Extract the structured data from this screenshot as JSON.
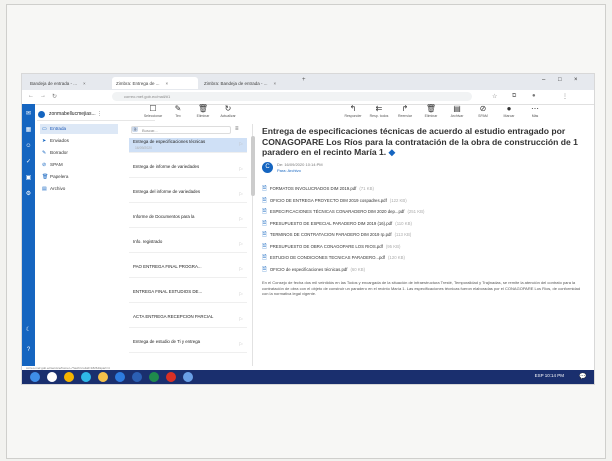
{
  "browser": {
    "tabs": [
      {
        "label": "Bandeja de entrada - ...",
        "active": false
      },
      {
        "label": "Zimbra: Entrega de ...",
        "active": true
      },
      {
        "label": "Zimbra: Bandeja de entrada - ...",
        "active": false
      }
    ],
    "new_tab": "+",
    "window_controls": [
      "–",
      "□",
      "×"
    ],
    "url": "correo.mef.gob.ec/mail/#1"
  },
  "rail_icons": [
    "mail-icon",
    "calendar-icon",
    "contacts-icon",
    "tasks-icon",
    "briefcase-icon",
    "settings-icon"
  ],
  "bottom_rail_icons": [
    "moon-icon",
    "help-icon"
  ],
  "account": {
    "label": "zonmabellucmejias..."
  },
  "folders": [
    {
      "label": "Entrada",
      "icon": "inbox-icon",
      "selected": true,
      "badge": "1"
    },
    {
      "label": "Enviados",
      "icon": "send-icon",
      "selected": false,
      "badge": ""
    },
    {
      "label": "Borrador",
      "icon": "draft-icon",
      "selected": false,
      "badge": ""
    },
    {
      "label": "SPAM",
      "icon": "spam-icon",
      "selected": false,
      "badge": ""
    },
    {
      "label": "Papelera",
      "icon": "trash-icon",
      "selected": false,
      "badge": ""
    },
    {
      "label": "Archivo",
      "icon": "archive-icon",
      "selected": false,
      "badge": ""
    }
  ],
  "toolbar_left": [
    {
      "label": "Seleccionar",
      "glyph": "☐"
    },
    {
      "label": "Tex",
      "glyph": "✎"
    },
    {
      "label": "Eliminar",
      "glyph": "🗑"
    },
    {
      "label": "Actualizar",
      "glyph": "↻"
    }
  ],
  "toolbar_right": [
    {
      "label": "Responder",
      "glyph": "↰"
    },
    {
      "label": "Resp. todos",
      "glyph": "⇇"
    },
    {
      "label": "Reenviar",
      "glyph": "↱"
    },
    {
      "label": "Eliminar",
      "glyph": "🗑"
    },
    {
      "label": "Archivar",
      "glyph": "▤"
    },
    {
      "label": "SPAM",
      "glyph": "⊘"
    },
    {
      "label": "Marcar",
      "glyph": "●"
    },
    {
      "label": "Más",
      "glyph": "⋯"
    }
  ],
  "search_placeholder": "Buscar...",
  "messages": [
    {
      "subject": "Entrega de especificaciones técnicas",
      "meta": "16/09/2020",
      "selected": true
    },
    {
      "subject": "Entrega de informe de variedades",
      "meta": "",
      "selected": false
    },
    {
      "subject": "Entrega del informe de variedades",
      "meta": "",
      "selected": false
    },
    {
      "subject": "Informe de Documentos para la",
      "meta": "",
      "selected": false
    },
    {
      "subject": "Info. registrado",
      "meta": "",
      "selected": false
    },
    {
      "subject": "PAO ENTREGA FINAL PROGRA...",
      "meta": "",
      "selected": false
    },
    {
      "subject": "ENTREGA FINAL ESTUDIOS DE...",
      "meta": "",
      "selected": false
    },
    {
      "subject": "ACTA ENTREGA RECEPCION PARCIAL",
      "meta": "",
      "selected": false
    },
    {
      "subject": "Entrega de estudio de Ti y entrega",
      "meta": "",
      "selected": false
    }
  ],
  "email": {
    "title": "Entrega de especificaciones técnicas de acuerdo al estudio entragado por CONAGOPARE Los Ríos para la contratación de la obra de construcción de 1 paradero en el recinto María 1.",
    "sender": "De: 16/09/2020 10:14:PM",
    "to": "Para: Archivo",
    "attachments": [
      {
        "name": "FORMATOS INVOLUCRADOS DIM 2019.pdf",
        "size": "(71 KB)"
      },
      {
        "name": "OFICIO DE ENTREGA PROYECTO DIM 2019 cospadres.pdf",
        "size": "(122 KB)"
      },
      {
        "name": "ESPECIFICACIONES TÉCNICAS CONARADERO DIM 2020 dep...pdf",
        "size": "(251 KB)"
      },
      {
        "name": "PRESUPUESTO DE ESPECIAL PARADERO DIM 2019 (16).pdf",
        "size": "(110 KB)"
      },
      {
        "name": "TERMINOS DE CONTRATACION PARADERO DIM 2019 rp.pdf",
        "size": "(113 KB)"
      },
      {
        "name": "PRESUPUESTO DE OBRA CONAGOPARE LOS RIOS.pdf",
        "size": "(95 KB)"
      },
      {
        "name": "ESTUDIO DE CONDICIONES TECNICAS PARADERO...pdf",
        "size": "(120 KB)"
      },
      {
        "name": "OFICIO de especificaciones técnicas.pdf",
        "size": "(60 KB)"
      }
    ],
    "body": "En el Consejo de fecha dos mil veintidós en las Todos y encargada de la situación de infraestructura Tresté, Temporalidad y Trajinadas, se remite la atención del contrato para la contratación de obra con el objeto de construir un paradero en el recinto María 1. Las especificaciones técnicas fueron elaboradas por el CONAGOPARE Los Ríos, de conformidad con la normativa legal vigente."
  },
  "status_url": "correo.mef.gob.ec/service/home/~/?auth=co&id=18264&part=4",
  "taskbar": {
    "icons": [
      "windows-icon",
      "search-icon",
      "chrome-icon",
      "edge-icon",
      "folder-icon",
      "mail-icon",
      "word-icon",
      "excel-icon",
      "pdf-icon",
      "app-icon"
    ],
    "tray_text": "ESP  10:14 PM",
    "notification": "💬"
  }
}
